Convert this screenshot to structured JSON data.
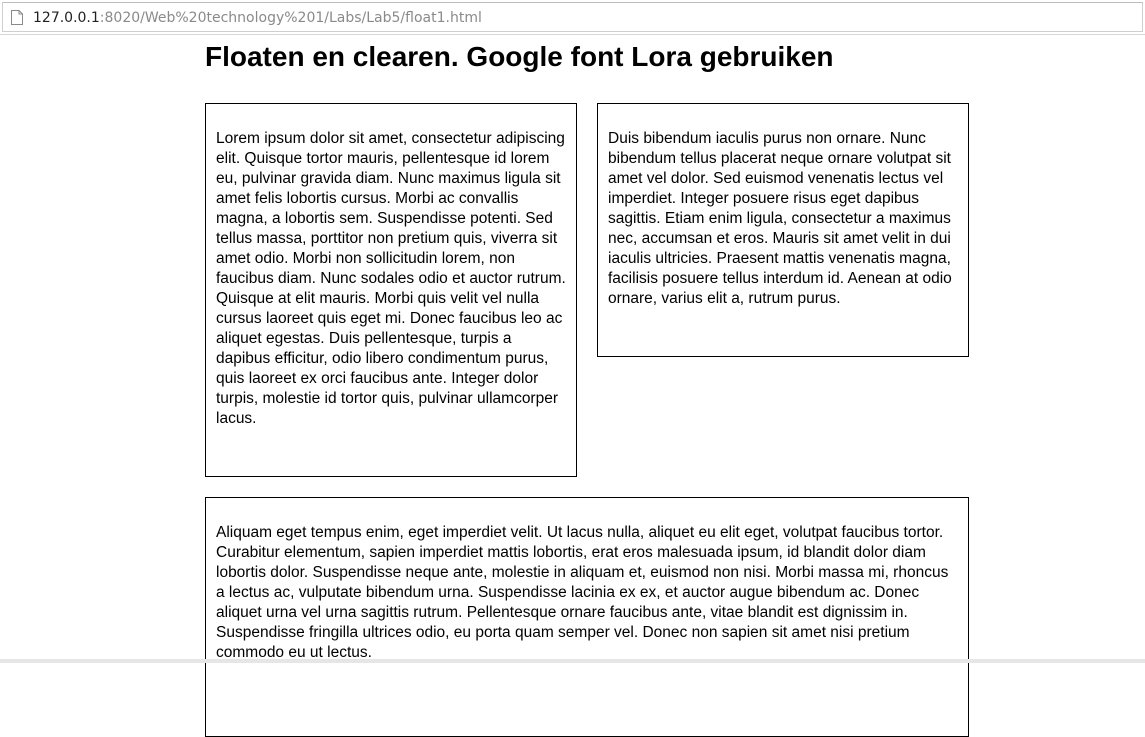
{
  "browser": {
    "url_host": "127.0.0.1",
    "url_rest": ":8020/Web%20technology%201/Labs/Lab5/float1.html",
    "page_icon": "page-icon"
  },
  "page": {
    "title": "Floaten en clearen. Google font Lora gebruiken",
    "box1_text": "Lorem ipsum dolor sit amet, consectetur adipiscing elit. Quisque tortor mauris, pellentesque id lorem eu, pulvinar gravida diam. Nunc maximus ligula sit amet felis lobortis cursus. Morbi ac convallis magna, a lobortis sem. Suspendisse potenti. Sed tellus massa, porttitor non pretium quis, viverra sit amet odio. Morbi non sollicitudin lorem, non faucibus diam. Nunc sodales odio et auctor rutrum. Quisque at elit mauris. Morbi quis velit vel nulla cursus laoreet quis eget mi. Donec faucibus leo ac aliquet egestas. Duis pellentesque, turpis a dapibus efficitur, odio libero condimentum purus, quis laoreet ex orci faucibus ante. Integer dolor turpis, molestie id tortor quis, pulvinar ullamcorper lacus.",
    "box2_text": "Duis bibendum iaculis purus non ornare. Nunc bibendum tellus placerat neque ornare volutpat sit amet vel dolor. Sed euismod venenatis lectus vel imperdiet. Integer posuere risus eget dapibus sagittis. Etiam enim ligula, consectetur a maximus nec, accumsan et eros. Mauris sit amet velit in dui iaculis ultricies. Praesent mattis venenatis magna, facilisis posuere tellus interdum id. Aenean at odio ornare, varius elit a, rutrum purus.",
    "box3_text": "Aliquam eget tempus enim, eget imperdiet velit. Ut lacus nulla, aliquet eu elit eget, volutpat faucibus tortor. Curabitur elementum, sapien imperdiet mattis lobortis, erat eros malesuada ipsum, id blandit dolor diam lobortis dolor. Suspendisse neque ante, molestie in aliquam et, euismod non nisi. Morbi massa mi, rhoncus a lectus ac, vulputate bibendum urna. Suspendisse lacinia ex ex, et auctor augue bibendum ac. Donec aliquet urna vel urna sagittis rutrum. Pellentesque ornare faucibus ante, vitae blandit est dignissim in. Suspendisse fringilla ultrices odio, eu porta quam semper vel. Donec non sapien sit amet nisi pretium commodo eu ut lectus."
  }
}
